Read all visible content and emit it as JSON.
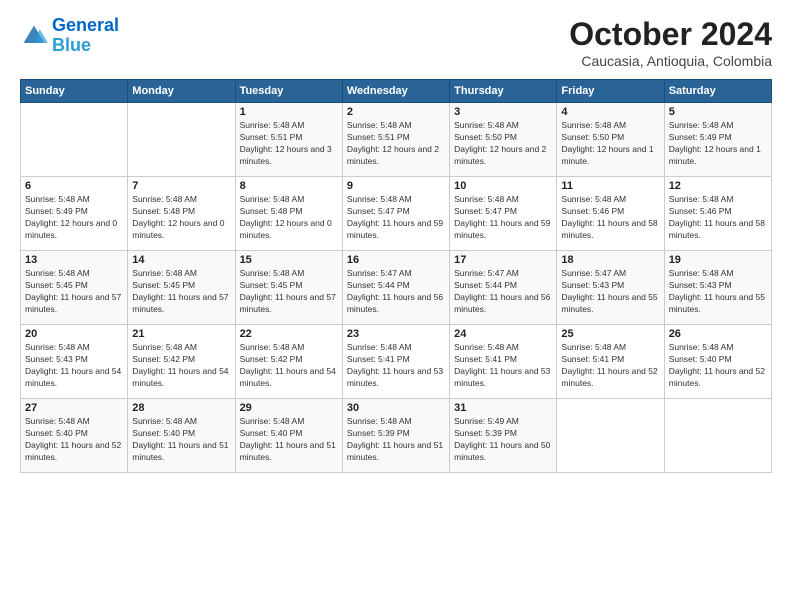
{
  "header": {
    "logo_line1": "General",
    "logo_line2": "Blue",
    "month_title": "October 2024",
    "subtitle": "Caucasia, Antioquia, Colombia"
  },
  "days_of_week": [
    "Sunday",
    "Monday",
    "Tuesday",
    "Wednesday",
    "Thursday",
    "Friday",
    "Saturday"
  ],
  "weeks": [
    [
      null,
      null,
      {
        "day": 1,
        "sunrise": "5:48 AM",
        "sunset": "5:51 PM",
        "daylight": "12 hours and 3 minutes."
      },
      {
        "day": 2,
        "sunrise": "5:48 AM",
        "sunset": "5:51 PM",
        "daylight": "12 hours and 2 minutes."
      },
      {
        "day": 3,
        "sunrise": "5:48 AM",
        "sunset": "5:50 PM",
        "daylight": "12 hours and 2 minutes."
      },
      {
        "day": 4,
        "sunrise": "5:48 AM",
        "sunset": "5:50 PM",
        "daylight": "12 hours and 1 minute."
      },
      {
        "day": 5,
        "sunrise": "5:48 AM",
        "sunset": "5:49 PM",
        "daylight": "12 hours and 1 minute."
      }
    ],
    [
      {
        "day": 6,
        "sunrise": "5:48 AM",
        "sunset": "5:49 PM",
        "daylight": "12 hours and 0 minutes."
      },
      {
        "day": 7,
        "sunrise": "5:48 AM",
        "sunset": "5:48 PM",
        "daylight": "12 hours and 0 minutes."
      },
      {
        "day": 8,
        "sunrise": "5:48 AM",
        "sunset": "5:48 PM",
        "daylight": "12 hours and 0 minutes."
      },
      {
        "day": 9,
        "sunrise": "5:48 AM",
        "sunset": "5:47 PM",
        "daylight": "11 hours and 59 minutes."
      },
      {
        "day": 10,
        "sunrise": "5:48 AM",
        "sunset": "5:47 PM",
        "daylight": "11 hours and 59 minutes."
      },
      {
        "day": 11,
        "sunrise": "5:48 AM",
        "sunset": "5:46 PM",
        "daylight": "11 hours and 58 minutes."
      },
      {
        "day": 12,
        "sunrise": "5:48 AM",
        "sunset": "5:46 PM",
        "daylight": "11 hours and 58 minutes."
      }
    ],
    [
      {
        "day": 13,
        "sunrise": "5:48 AM",
        "sunset": "5:45 PM",
        "daylight": "11 hours and 57 minutes."
      },
      {
        "day": 14,
        "sunrise": "5:48 AM",
        "sunset": "5:45 PM",
        "daylight": "11 hours and 57 minutes."
      },
      {
        "day": 15,
        "sunrise": "5:48 AM",
        "sunset": "5:45 PM",
        "daylight": "11 hours and 57 minutes."
      },
      {
        "day": 16,
        "sunrise": "5:47 AM",
        "sunset": "5:44 PM",
        "daylight": "11 hours and 56 minutes."
      },
      {
        "day": 17,
        "sunrise": "5:47 AM",
        "sunset": "5:44 PM",
        "daylight": "11 hours and 56 minutes."
      },
      {
        "day": 18,
        "sunrise": "5:47 AM",
        "sunset": "5:43 PM",
        "daylight": "11 hours and 55 minutes."
      },
      {
        "day": 19,
        "sunrise": "5:48 AM",
        "sunset": "5:43 PM",
        "daylight": "11 hours and 55 minutes."
      }
    ],
    [
      {
        "day": 20,
        "sunrise": "5:48 AM",
        "sunset": "5:43 PM",
        "daylight": "11 hours and 54 minutes."
      },
      {
        "day": 21,
        "sunrise": "5:48 AM",
        "sunset": "5:42 PM",
        "daylight": "11 hours and 54 minutes."
      },
      {
        "day": 22,
        "sunrise": "5:48 AM",
        "sunset": "5:42 PM",
        "daylight": "11 hours and 54 minutes."
      },
      {
        "day": 23,
        "sunrise": "5:48 AM",
        "sunset": "5:41 PM",
        "daylight": "11 hours and 53 minutes."
      },
      {
        "day": 24,
        "sunrise": "5:48 AM",
        "sunset": "5:41 PM",
        "daylight": "11 hours and 53 minutes."
      },
      {
        "day": 25,
        "sunrise": "5:48 AM",
        "sunset": "5:41 PM",
        "daylight": "11 hours and 52 minutes."
      },
      {
        "day": 26,
        "sunrise": "5:48 AM",
        "sunset": "5:40 PM",
        "daylight": "11 hours and 52 minutes."
      }
    ],
    [
      {
        "day": 27,
        "sunrise": "5:48 AM",
        "sunset": "5:40 PM",
        "daylight": "11 hours and 52 minutes."
      },
      {
        "day": 28,
        "sunrise": "5:48 AM",
        "sunset": "5:40 PM",
        "daylight": "11 hours and 51 minutes."
      },
      {
        "day": 29,
        "sunrise": "5:48 AM",
        "sunset": "5:40 PM",
        "daylight": "11 hours and 51 minutes."
      },
      {
        "day": 30,
        "sunrise": "5:48 AM",
        "sunset": "5:39 PM",
        "daylight": "11 hours and 51 minutes."
      },
      {
        "day": 31,
        "sunrise": "5:49 AM",
        "sunset": "5:39 PM",
        "daylight": "11 hours and 50 minutes."
      },
      null,
      null
    ]
  ]
}
